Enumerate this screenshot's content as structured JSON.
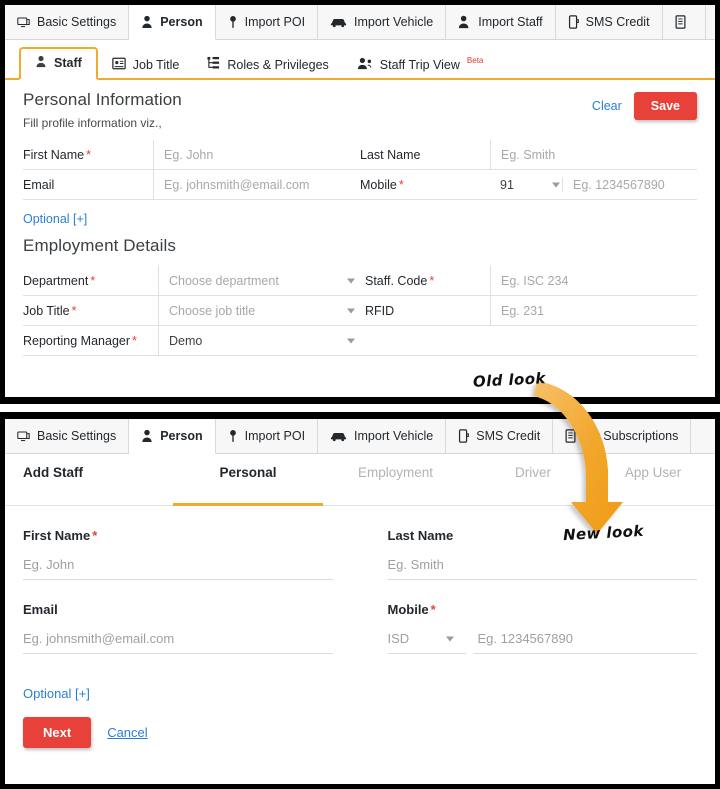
{
  "colors": {
    "accent_orange": "#f0ab2b",
    "danger_red": "#e8413a",
    "link_blue": "#2a7fd4",
    "muted_gray": "#a8a8a8",
    "arrow_orange": "#f3a92e"
  },
  "annotations": {
    "old_look": "Old look",
    "new_look": "New look"
  },
  "old_panel": {
    "module_tabs": [
      {
        "label": "Basic Settings",
        "icon": "monitor-icon",
        "active": false
      },
      {
        "label": "Person",
        "icon": "person-icon",
        "active": true
      },
      {
        "label": "Import POI",
        "icon": "map-pin-icon",
        "active": false
      },
      {
        "label": "Import Vehicle",
        "icon": "car-icon",
        "active": false
      },
      {
        "label": "Import Staff",
        "icon": "person-add-icon",
        "active": false
      },
      {
        "label": "SMS Credit",
        "icon": "mobile-icon",
        "active": false
      },
      {
        "label": "",
        "icon": "document-icon",
        "active": false
      }
    ],
    "sub_tabs": [
      {
        "label": "Staff",
        "icon": "user-icon",
        "active": true,
        "badge": ""
      },
      {
        "label": "Job Title",
        "icon": "id-card-icon",
        "active": false,
        "badge": ""
      },
      {
        "label": "Roles & Privileges",
        "icon": "hierarchy-icon",
        "active": false,
        "badge": ""
      },
      {
        "label": "Staff Trip View",
        "icon": "users-icon",
        "active": false,
        "badge": "Beta"
      }
    ],
    "personal_section": {
      "title": "Personal Information",
      "subtitle": "Fill profile information viz.,",
      "clear_label": "Clear",
      "save_label": "Save",
      "rows": [
        {
          "left_label": "First Name",
          "left_required": true,
          "left_value": "Eg. John",
          "left_type": "text",
          "right_label": "Last Name",
          "right_required": false,
          "right_value": "Eg. Smith",
          "right_type": "text"
        },
        {
          "left_label": "Email",
          "left_required": false,
          "left_value": "Eg. johnsmith@email.com",
          "left_type": "text",
          "right_label": "Mobile ",
          "right_required": true,
          "right_value": "Eg. 1234567890",
          "right_type": "mobile",
          "right_isd": "91"
        }
      ],
      "optional_label": "Optional [+]"
    },
    "employment_section": {
      "title": "Employment Details",
      "rows": [
        {
          "left_label": "Department ",
          "left_required": true,
          "left_value": "Choose department",
          "left_type": "select",
          "right_label": "Staff. Code ",
          "right_required": true,
          "right_value": "Eg. ISC 234",
          "right_type": "text"
        },
        {
          "left_label": "Job Title ",
          "left_required": true,
          "left_value": "Choose job title",
          "left_type": "select",
          "right_label": "RFID",
          "right_required": false,
          "right_value": "Eg. 231",
          "right_type": "text",
          "has_add_button": true
        },
        {
          "left_label": "Reporting Manager ",
          "left_required": true,
          "left_value": "Demo",
          "left_type": "select-filled",
          "right_label": "",
          "right_required": false,
          "right_value": "",
          "right_type": "blank"
        }
      ],
      "add_button_label": "+"
    }
  },
  "new_panel": {
    "module_tabs": [
      {
        "label": "Basic Settings",
        "icon": "monitor-icon",
        "active": false
      },
      {
        "label": "Person",
        "icon": "person-icon",
        "active": true
      },
      {
        "label": "Import POI",
        "icon": "map-pin-icon",
        "active": false
      },
      {
        "label": "Import Vehicle",
        "icon": "car-icon",
        "active": false
      },
      {
        "label": "SMS Credit",
        "icon": "mobile-icon",
        "active": false
      },
      {
        "label": "My Subscriptions",
        "icon": "document-icon",
        "active": false
      }
    ],
    "steps": [
      {
        "label": "Add Staff",
        "state": "heading"
      },
      {
        "label": "Personal",
        "state": "active"
      },
      {
        "label": "Employment",
        "state": "inactive"
      },
      {
        "label": "Driver",
        "state": "inactive"
      },
      {
        "label": "App User",
        "state": "inactive"
      }
    ],
    "fields": {
      "first_name_label": "First Name",
      "first_name_placeholder": "Eg. John",
      "last_name_label": "Last Name",
      "last_name_placeholder": "Eg. Smith",
      "email_label": "Email",
      "email_placeholder": "Eg. johnsmith@email.com",
      "mobile_label": "Mobile",
      "mobile_isd_placeholder": "ISD",
      "mobile_placeholder": "Eg. 1234567890"
    },
    "optional_label": "Optional [+]",
    "next_label": "Next",
    "cancel_label": "Cancel"
  }
}
